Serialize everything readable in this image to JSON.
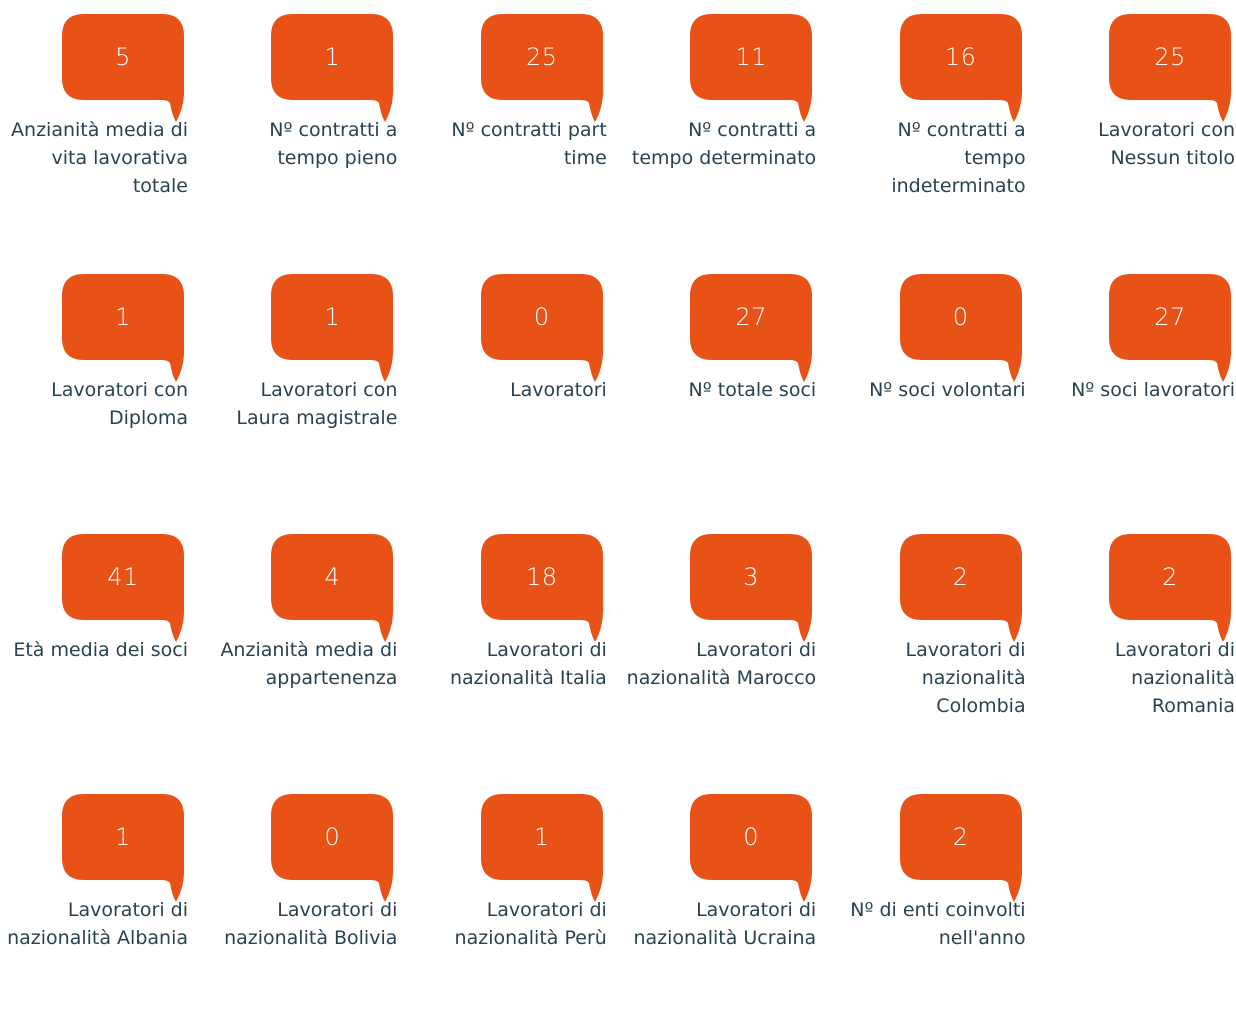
{
  "accent_color": "#E85217",
  "text_color": "#2A4250",
  "icon": "speech-bubble-icon",
  "stats": [
    {
      "value": "5",
      "label": "Anzianità media di vita lavorativa totale"
    },
    {
      "value": "1",
      "label": "Nº contratti a tempo pieno"
    },
    {
      "value": "25",
      "label": "Nº contratti part time"
    },
    {
      "value": "11",
      "label": "Nº contratti a tempo determinato"
    },
    {
      "value": "16",
      "label": "Nº contratti a tempo indeterminato"
    },
    {
      "value": "25",
      "label": "Lavoratori con Nessun titolo"
    },
    {
      "value": "1",
      "label": "Lavoratori con Diploma"
    },
    {
      "value": "1",
      "label": "Lavoratori con Laura magistrale"
    },
    {
      "value": "0",
      "label": "Lavoratori"
    },
    {
      "value": "27",
      "label": "Nº totale soci"
    },
    {
      "value": "0",
      "label": "Nº soci volontari"
    },
    {
      "value": "27",
      "label": "Nº soci lavoratori"
    },
    {
      "value": "41",
      "label": "Età media dei soci"
    },
    {
      "value": "4",
      "label": "Anzianità media di appartenenza"
    },
    {
      "value": "18",
      "label": "Lavoratori di nazionalità Italia"
    },
    {
      "value": "3",
      "label": "Lavoratori di nazionalità Marocco"
    },
    {
      "value": "2",
      "label": "Lavoratori di nazionalità Colombia"
    },
    {
      "value": "2",
      "label": "Lavoratori di nazionalità Romania"
    },
    {
      "value": "1",
      "label": "Lavoratori di nazionalità Albania"
    },
    {
      "value": "0",
      "label": "Lavoratori di nazionalità Bolivia"
    },
    {
      "value": "1",
      "label": "Lavoratori di nazionalità Perù"
    },
    {
      "value": "0",
      "label": "Lavoratori di nazionalità Ucraina"
    },
    {
      "value": "2",
      "label": "Nº di enti coinvolti nell'anno"
    }
  ]
}
